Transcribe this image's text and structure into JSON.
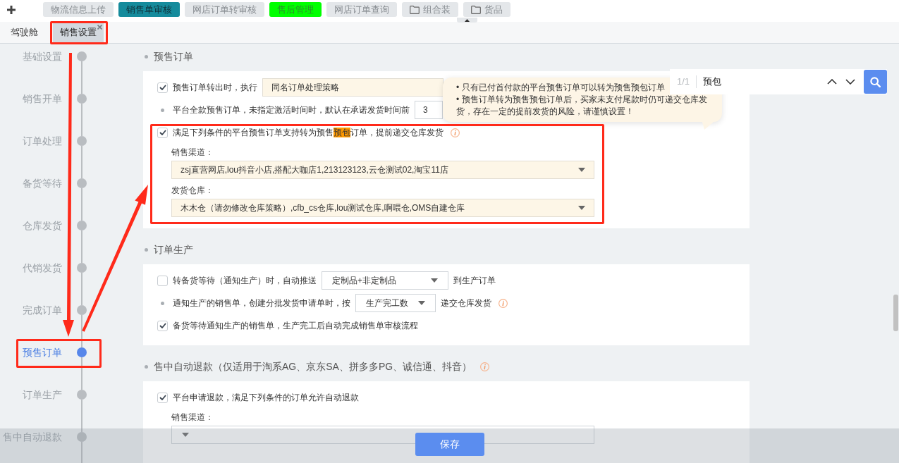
{
  "top_tabs": [
    {
      "label": "物流信息上传",
      "selected": false,
      "kind": "page"
    },
    {
      "label": "销售单审核",
      "selected": true,
      "kind": "page"
    },
    {
      "label": "网店订单转审核",
      "selected": false,
      "kind": "page"
    },
    {
      "label": "售后管理",
      "selected": false,
      "kind": "page",
      "color": "#00ff00"
    },
    {
      "label": "网店订单查询",
      "selected": false,
      "kind": "page"
    },
    {
      "label": "组合装",
      "selected": false,
      "kind": "folder"
    },
    {
      "label": "货品",
      "selected": false,
      "kind": "folder"
    }
  ],
  "open_tabs": [
    {
      "label": "驾驶舱",
      "selected": false,
      "closable": false
    },
    {
      "label": "销售设置",
      "selected": true,
      "closable": true
    }
  ],
  "timeline": [
    {
      "label": "基础设置",
      "selected": false
    },
    {
      "label": "销售开单",
      "selected": false
    },
    {
      "label": "订单处理",
      "selected": false
    },
    {
      "label": "备货等待",
      "selected": false
    },
    {
      "label": "仓库发货",
      "selected": false
    },
    {
      "label": "代销发货",
      "selected": false
    },
    {
      "label": "完成订单",
      "selected": false
    },
    {
      "label": "预售订单",
      "selected": true
    },
    {
      "label": "订单生产",
      "selected": false
    },
    {
      "label": "售中自动退款",
      "selected": false
    }
  ],
  "sections": [
    {
      "title": "预售订单",
      "info": false,
      "rows": [
        {
          "kind": "checkbox",
          "checked": true,
          "parts": [
            {
              "kind": "text",
              "text": "预售订单转出时，执行"
            },
            {
              "kind": "select",
              "value": "同名订单处理策略",
              "highlighted": true,
              "caret": false
            }
          ]
        },
        {
          "kind": "bullet",
          "parts": [
            {
              "kind": "text",
              "text": "平台全款预售订单，未指定激活时间时，默认在承诺发货时间前"
            },
            {
              "kind": "input",
              "value": "3"
            }
          ]
        },
        {
          "kind": "checkbox",
          "checked": true,
          "parts": [
            {
              "kind": "text",
              "text": "满足下列条件的平台预售订单支持转为预售**预包**订单，提前递交仓库发货"
            },
            {
              "kind": "info"
            }
          ]
        },
        {
          "kind": "label",
          "text": "销售渠道："
        },
        {
          "kind": "select",
          "value": "zsj直营网店,lou抖音小店,搭配大咖店1,213123123,云仓测试02,淘宝11店",
          "highlighted": true,
          "caret": true
        },
        {
          "kind": "label",
          "text": "发货仓库："
        },
        {
          "kind": "select",
          "value": "木木仓（请勿修改仓库策略）,cfb_cs仓库,lou测试仓库,啊喂仓,OMS自建仓库",
          "highlighted": true,
          "caret": true
        }
      ]
    },
    {
      "title": "订单生产",
      "info": false,
      "rows": [
        {
          "kind": "checkbox",
          "checked": false,
          "parts": [
            {
              "kind": "text",
              "text": "转备货等待（通知生产）时，自动推送"
            },
            {
              "kind": "select",
              "value": "定制品+非定制品",
              "highlighted": false,
              "caret": true
            },
            {
              "kind": "text",
              "text": "到生产订单"
            }
          ]
        },
        {
          "kind": "bullet",
          "parts": [
            {
              "kind": "text",
              "text": "通知生产的销售单，创建分批发货申请单时，按"
            },
            {
              "kind": "select",
              "value": "生产完工数",
              "highlighted": false,
              "caret": true
            },
            {
              "kind": "text",
              "text": "递交仓库发货"
            },
            {
              "kind": "info"
            }
          ]
        },
        {
          "kind": "checkbox",
          "checked": true,
          "parts": [
            {
              "kind": "text",
              "text": "备货等待通知生产的销售单，生产完工后自动完成销售单审核流程"
            }
          ]
        }
      ]
    },
    {
      "title": "售中自动退款（仅适用于淘系AG、京东SA、拼多多PG、诚信通、抖音）",
      "info": true,
      "rows": [
        {
          "kind": "checkbox",
          "checked": true,
          "parts": [
            {
              "kind": "text",
              "text": "平台申请退款，满足下列条件的订单允许自动退款"
            }
          ]
        },
        {
          "kind": "label",
          "text": "销售渠道："
        },
        {
          "kind": "select",
          "highlighted": false,
          "caret": true
        }
      ]
    }
  ],
  "tooltip": {
    "lines": [
      "• 只有已付首付款的平台预售订单可以转为预售预包订单",
      "• 预售订单转为预售预包订单后，买家未支付尾款时仍可递交仓库发货，存在一定的提前发货的风险，请谨慎设置！"
    ]
  },
  "find_bar": {
    "count": "1/1",
    "query": "预包"
  },
  "save_button": "保存"
}
